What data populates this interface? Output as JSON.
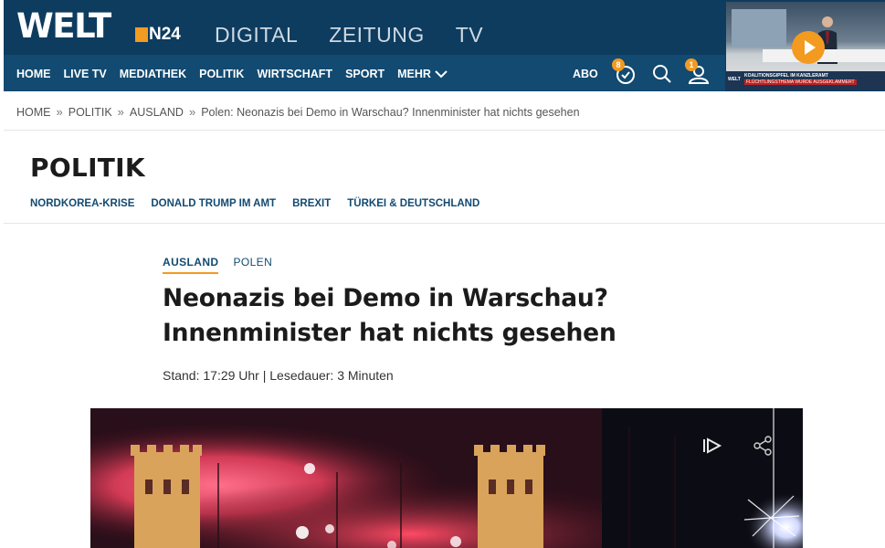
{
  "header": {
    "logo": "WELT",
    "logo_sub": "N24",
    "top_nav": [
      "DIGITAL",
      "ZEITUNG",
      "TV"
    ],
    "main_nav": [
      "HOME",
      "LIVE TV",
      "MEDIATHEK",
      "POLITIK",
      "WIRTSCHAFT",
      "SPORT"
    ],
    "more_label": "MEHR",
    "abo_label": "ABO",
    "watchlist_count": "8",
    "notification_count": "1",
    "accent_color": "#f39a21",
    "bar_color": "#0d3c5f"
  },
  "teaser": {
    "ticker_label": "WELT",
    "ticker_line1": "KOALITIONSGIPFEL IM KANZLERAMT",
    "ticker_line2": "FLÜCHTLINGSTHEMA WURDE AUSGEKLAMMERT"
  },
  "breadcrumb": {
    "items": [
      "HOME",
      "POLITIK",
      "AUSLAND"
    ],
    "current": "Polen: Neonazis bei Demo in Warschau? Innenminister hat nichts gesehen",
    "separator": "»"
  },
  "section": {
    "title": "POLITIK",
    "subnav": [
      "NORDKOREA-KRISE",
      "DONALD TRUMP IM AMT",
      "BREXIT",
      "TÜRKEI & DEUTSCHLAND"
    ]
  },
  "article": {
    "tag_main": "AUSLAND",
    "tag_sub": "POLEN",
    "headline_line1": "Neonazis bei Demo in Warschau?",
    "headline_line2": "Innenminister hat nichts gesehen",
    "meta": "Stand: 17:29 Uhr | Lesedauer: 3 Minuten"
  },
  "hero": {
    "icons": [
      "gallery-play-icon",
      "share-icon"
    ]
  }
}
